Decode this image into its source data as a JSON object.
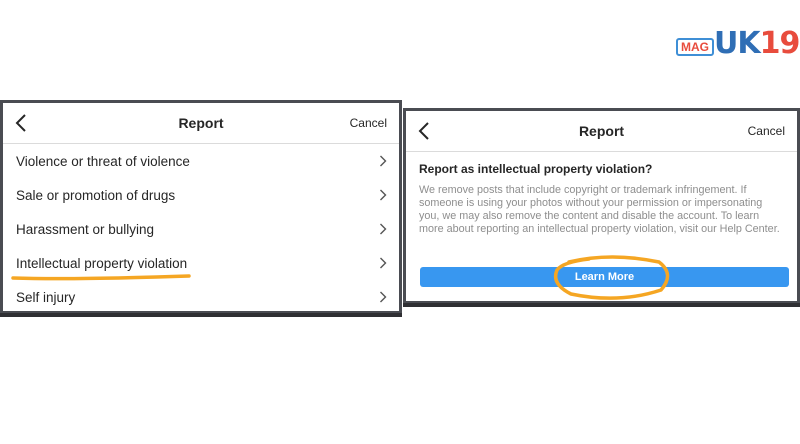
{
  "logo": {
    "mag": "MAG",
    "brand_part1": "UΚ",
    "brand_part2": "19"
  },
  "left_panel": {
    "title": "Report",
    "cancel_label": "Cancel",
    "items": [
      {
        "label": "Violence or threat of violence"
      },
      {
        "label": "Sale or promotion of drugs"
      },
      {
        "label": "Harassment or bullying"
      },
      {
        "label": "Intellectual property violation"
      },
      {
        "label": "Self injury"
      }
    ]
  },
  "right_panel": {
    "title": "Report",
    "cancel_label": "Cancel",
    "question": "Report as intellectual property violation?",
    "description": "We remove posts that include copyright or trademark infringement. If someone is using your photos without your permission or impersonating you, we may also remove the content and disable the account. To learn more about reporting an intellectual property violation, visit our Help Center.",
    "learn_more_label": "Learn More"
  },
  "colors": {
    "accent_blue": "#3897f0",
    "highlight_orange": "#f5a623",
    "text_dark": "#262626",
    "text_gray": "#8e8e8e"
  }
}
